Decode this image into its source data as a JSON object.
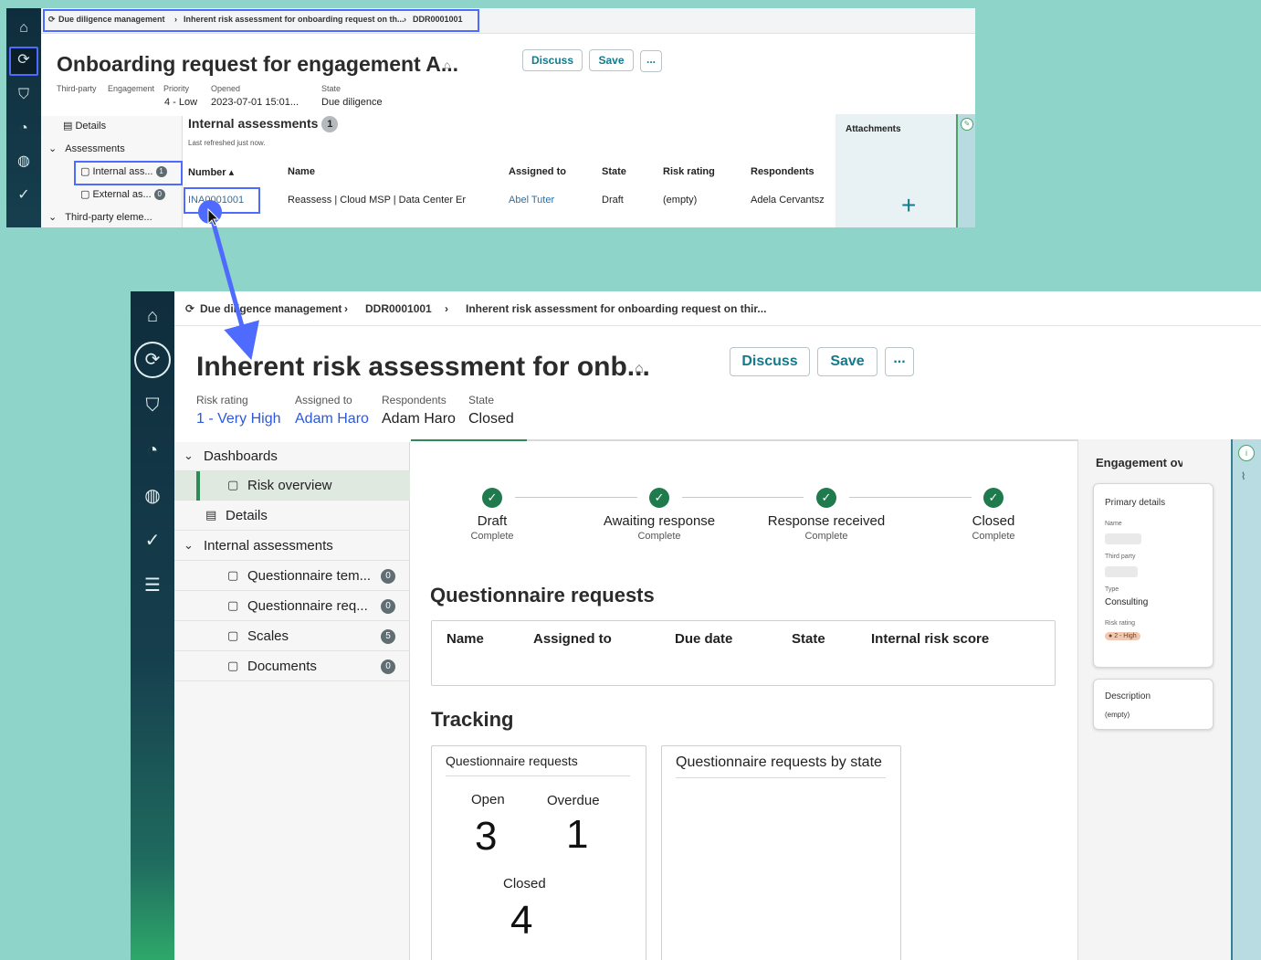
{
  "top": {
    "breadcrumb": [
      "Due diligence management",
      "Inherent risk assessment for onboarding request on th...",
      "DDR0001001"
    ],
    "title": "Onboarding request for engagement A...",
    "buttons": {
      "discuss": "Discuss",
      "save": "Save",
      "more": "..."
    },
    "meta": [
      {
        "label": "Third-party",
        "value": ""
      },
      {
        "label": "Engagement",
        "value": ""
      },
      {
        "label": "Priority",
        "value": "4 - Low"
      },
      {
        "label": "Opened",
        "value": "2023-07-01 15:01..."
      },
      {
        "label": "State",
        "value": "Due diligence"
      }
    ],
    "nav": {
      "details": "Details",
      "assessments": "Assessments",
      "internal": "Internal ass...",
      "internal_count": "1",
      "external": "External as...",
      "external_count": "0",
      "third_party": "Third-party eleme..."
    },
    "section_title": "Internal assessments",
    "section_count": "1",
    "refreshed": "Last refreshed just now.",
    "columns": [
      "Number",
      "Name",
      "Assigned to",
      "State",
      "Risk rating",
      "Respondents"
    ],
    "row": {
      "number": "INA0001001",
      "name": "Reassess | Cloud MSP | Data Center Er",
      "assigned_to": "Abel Tuter",
      "state": "Draft",
      "risk_rating": "(empty)",
      "respondents": "Adela Cervantsz"
    },
    "attachments": "Attachments",
    "add": "+"
  },
  "bottom": {
    "breadcrumb": [
      "Due diligence management",
      "DDR0001001",
      "Inherent risk assessment for onboarding request on thir..."
    ],
    "title": "Inherent risk assessment for onb...",
    "buttons": {
      "discuss": "Discuss",
      "save": "Save",
      "more": "..."
    },
    "meta": {
      "risk_rating_label": "Risk rating",
      "risk_rating": "1 - Very High",
      "assigned_label": "Assigned to",
      "assigned": "Adam Haro",
      "respondents_label": "Respondents",
      "respondents": "Adam Haro",
      "state_label": "State",
      "state": "Closed"
    },
    "nav": {
      "dashboards": "Dashboards",
      "risk_overview": "Risk overview",
      "details": "Details",
      "internal_assessments": "Internal assessments",
      "items": [
        {
          "label": "Questionnaire tem...",
          "count": "0"
        },
        {
          "label": "Questionnaire req...",
          "count": "0"
        },
        {
          "label": "Scales",
          "count": "5"
        },
        {
          "label": "Documents",
          "count": "0"
        }
      ]
    },
    "steps": [
      {
        "name": "Draft",
        "status": "Complete"
      },
      {
        "name": "Awaiting response",
        "status": "Complete"
      },
      {
        "name": "Response received",
        "status": "Complete"
      },
      {
        "name": "Closed",
        "status": "Complete"
      }
    ],
    "questionnaire_title": "Questionnaire requests",
    "q_columns": [
      "Name",
      "Assigned to",
      "Due date",
      "State",
      "Internal risk score"
    ],
    "tracking_title": "Tracking",
    "tracking_card_title": "Questionnaire requests",
    "kpis": {
      "open_label": "Open",
      "open": "3",
      "overdue_label": "Overdue",
      "overdue": "1",
      "closed_label": "Closed",
      "closed": "4"
    },
    "by_state_title": "Questionnaire requests by state",
    "side": {
      "title": "Engagement ove",
      "primary": "Primary details",
      "name_label": "Name",
      "third_party_label": "Third party",
      "type_label": "Type",
      "type": "Consulting",
      "risk_label": "Risk rating",
      "risk": "2 - High",
      "description_label": "Description",
      "description": "(empty)"
    }
  },
  "colors": {
    "accent": "#4f6bff",
    "link": "#2c58e0",
    "success": "#1f7a4d",
    "teal": "#127a8c",
    "background": "#8fd4c8"
  }
}
